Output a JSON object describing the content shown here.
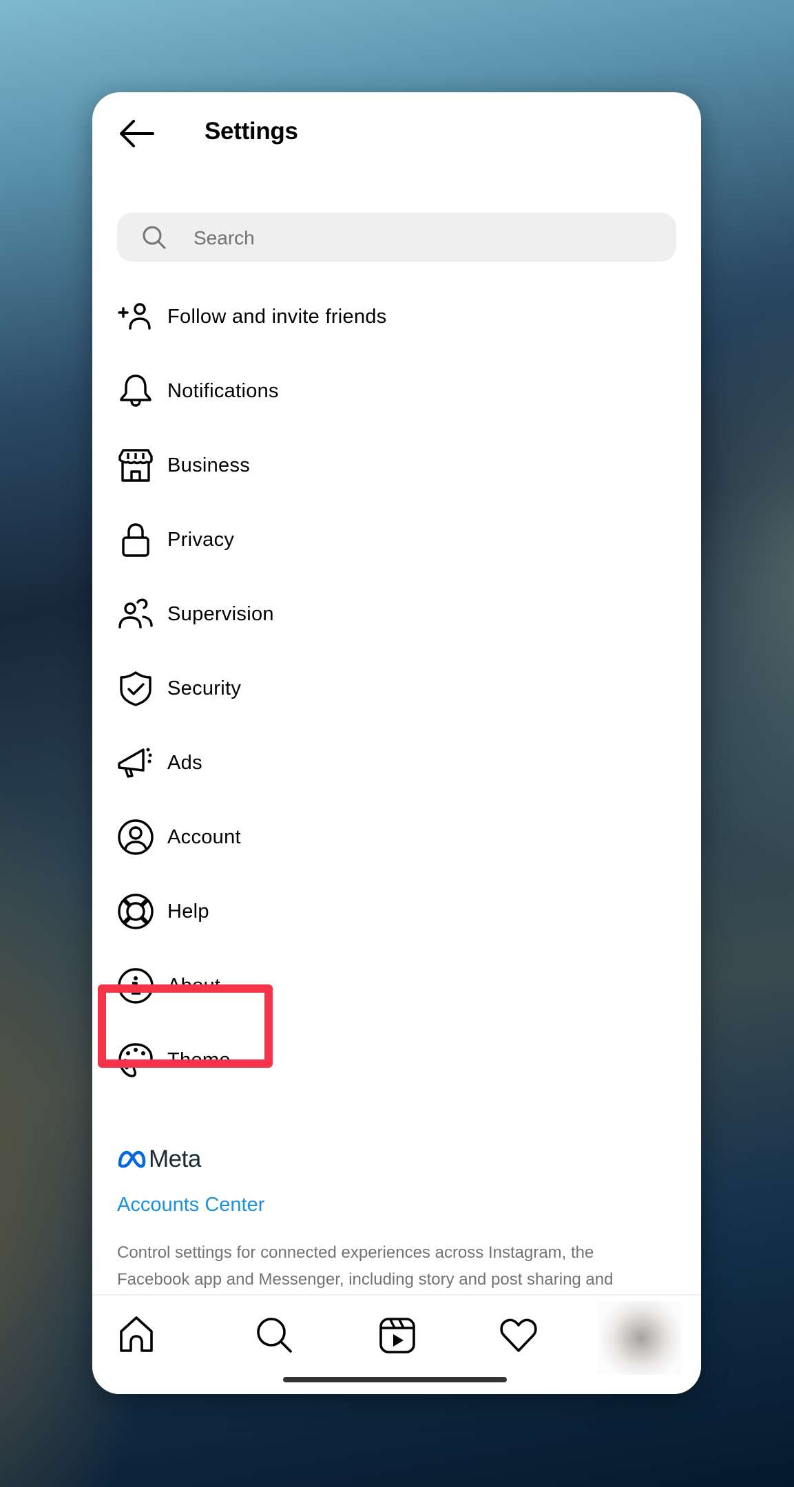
{
  "header": {
    "title": "Settings",
    "back_icon": "arrow-left-icon"
  },
  "search": {
    "placeholder": "Search",
    "value": "",
    "icon": "search-icon"
  },
  "menu": {
    "items": [
      {
        "label": "Follow and invite friends",
        "icon": "add-person-icon"
      },
      {
        "label": "Notifications",
        "icon": "bell-icon"
      },
      {
        "label": "Business",
        "icon": "storefront-icon"
      },
      {
        "label": "Privacy",
        "icon": "lock-icon"
      },
      {
        "label": "Supervision",
        "icon": "people-icon"
      },
      {
        "label": "Security",
        "icon": "shield-check-icon"
      },
      {
        "label": "Ads",
        "icon": "megaphone-icon"
      },
      {
        "label": "Account",
        "icon": "user-circle-icon",
        "highlighted": true
      },
      {
        "label": "Help",
        "icon": "lifebuoy-icon"
      },
      {
        "label": "About",
        "icon": "info-icon"
      },
      {
        "label": "Theme",
        "icon": "palette-icon"
      }
    ]
  },
  "meta_section": {
    "brand": "Meta",
    "brand_color": "#0668e1",
    "link_label": "Accounts Center",
    "link_color": "#1d8fe0",
    "description": "Control settings for connected experiences across Instagram, the Facebook app and Messenger, including story and post sharing and"
  },
  "highlight": {
    "target": "Account",
    "color": "#f43348"
  },
  "bottom_nav": {
    "items": [
      {
        "name": "home",
        "icon": "home-icon"
      },
      {
        "name": "search",
        "icon": "search-icon"
      },
      {
        "name": "reels",
        "icon": "reels-icon"
      },
      {
        "name": "activity",
        "icon": "heart-icon"
      },
      {
        "name": "profile",
        "icon": "avatar"
      }
    ]
  }
}
